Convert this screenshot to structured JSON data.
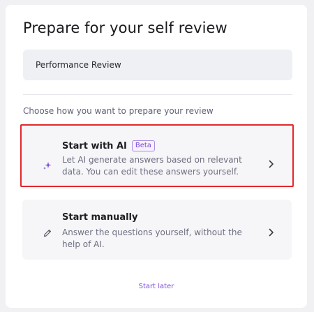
{
  "page": {
    "title": "Prepare for your self review",
    "review_name": "Performance Review",
    "subheading": "Choose how you want to prepare your review"
  },
  "options": [
    {
      "title": "Start with AI",
      "badge": "Beta",
      "description": "Let AI generate answers based on relevant data. You can edit these answers yourself.",
      "icon": "sparkle-icon",
      "highlighted": true
    },
    {
      "title": "Start manually",
      "description": "Answer the questions yourself, without the help of AI.",
      "icon": "pencil-icon",
      "highlighted": false
    }
  ],
  "footer": {
    "start_later_label": "Start later"
  },
  "colors": {
    "accent": "#7c4bd8",
    "highlight_border": "#e3262a",
    "option_bg": "#f6f6f8"
  }
}
